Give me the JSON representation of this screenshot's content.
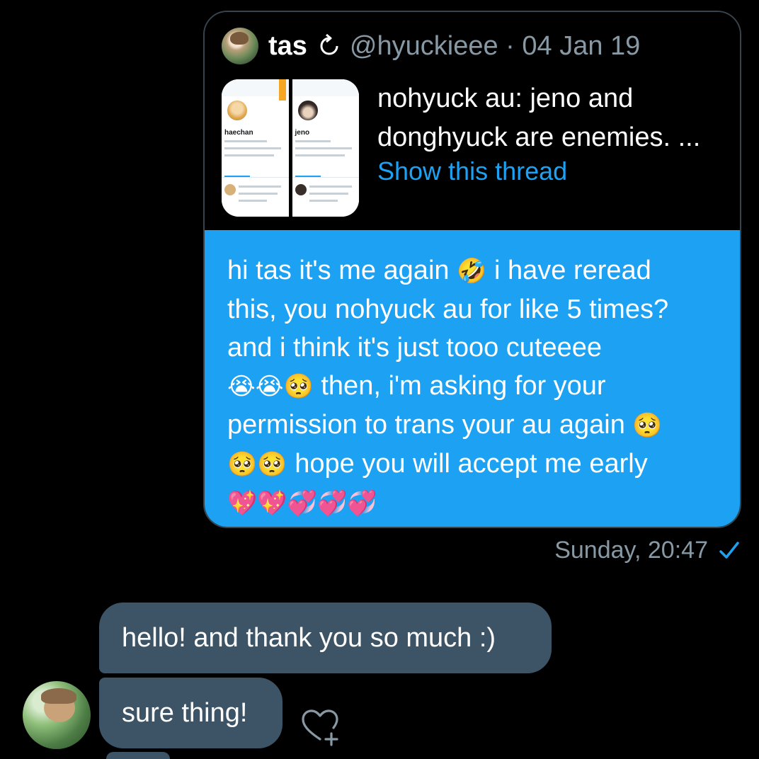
{
  "quoted_tweet": {
    "name": "tas",
    "handle_date": "@hyuckieee · 04 Jan 19",
    "text": "nohyuck au: jeno and donghyuck are enemies. ...",
    "show_thread": "Show this thread",
    "thumbnail": {
      "left_name": "haechan",
      "right_name": "jeno"
    }
  },
  "sent_message": {
    "line1_a": "hi tas it's me again ",
    "line1_b": " i have reread",
    "line2": "this, you nohyuck au for like 5 times?",
    "line3": "and i think it's just tooo cuteeee",
    "line4": " then, i'm asking for your",
    "line5_a": "permission to trans your au again ",
    "line6": " hope you will accept me early",
    "emoji_rofl": "🤣",
    "emoji_crying": "😭",
    "emoji_pleading": "🥺",
    "emoji_sparkle_heart": "💖",
    "emoji_two_hearts": "💞"
  },
  "timestamp": "Sunday, 20:47",
  "received_messages": [
    {
      "text": "hello! and thank you so much :)"
    },
    {
      "text": "sure thing!"
    }
  ],
  "colors": {
    "background": "#000000",
    "sent_bubble": "#1da1f2",
    "received_bubble": "#3d5466",
    "muted_text": "#8899a6",
    "link": "#1da1f2"
  },
  "icons": {
    "retweet": "retweet-icon",
    "read_receipt": "checkmark-icon",
    "react": "heart-plus-icon"
  }
}
